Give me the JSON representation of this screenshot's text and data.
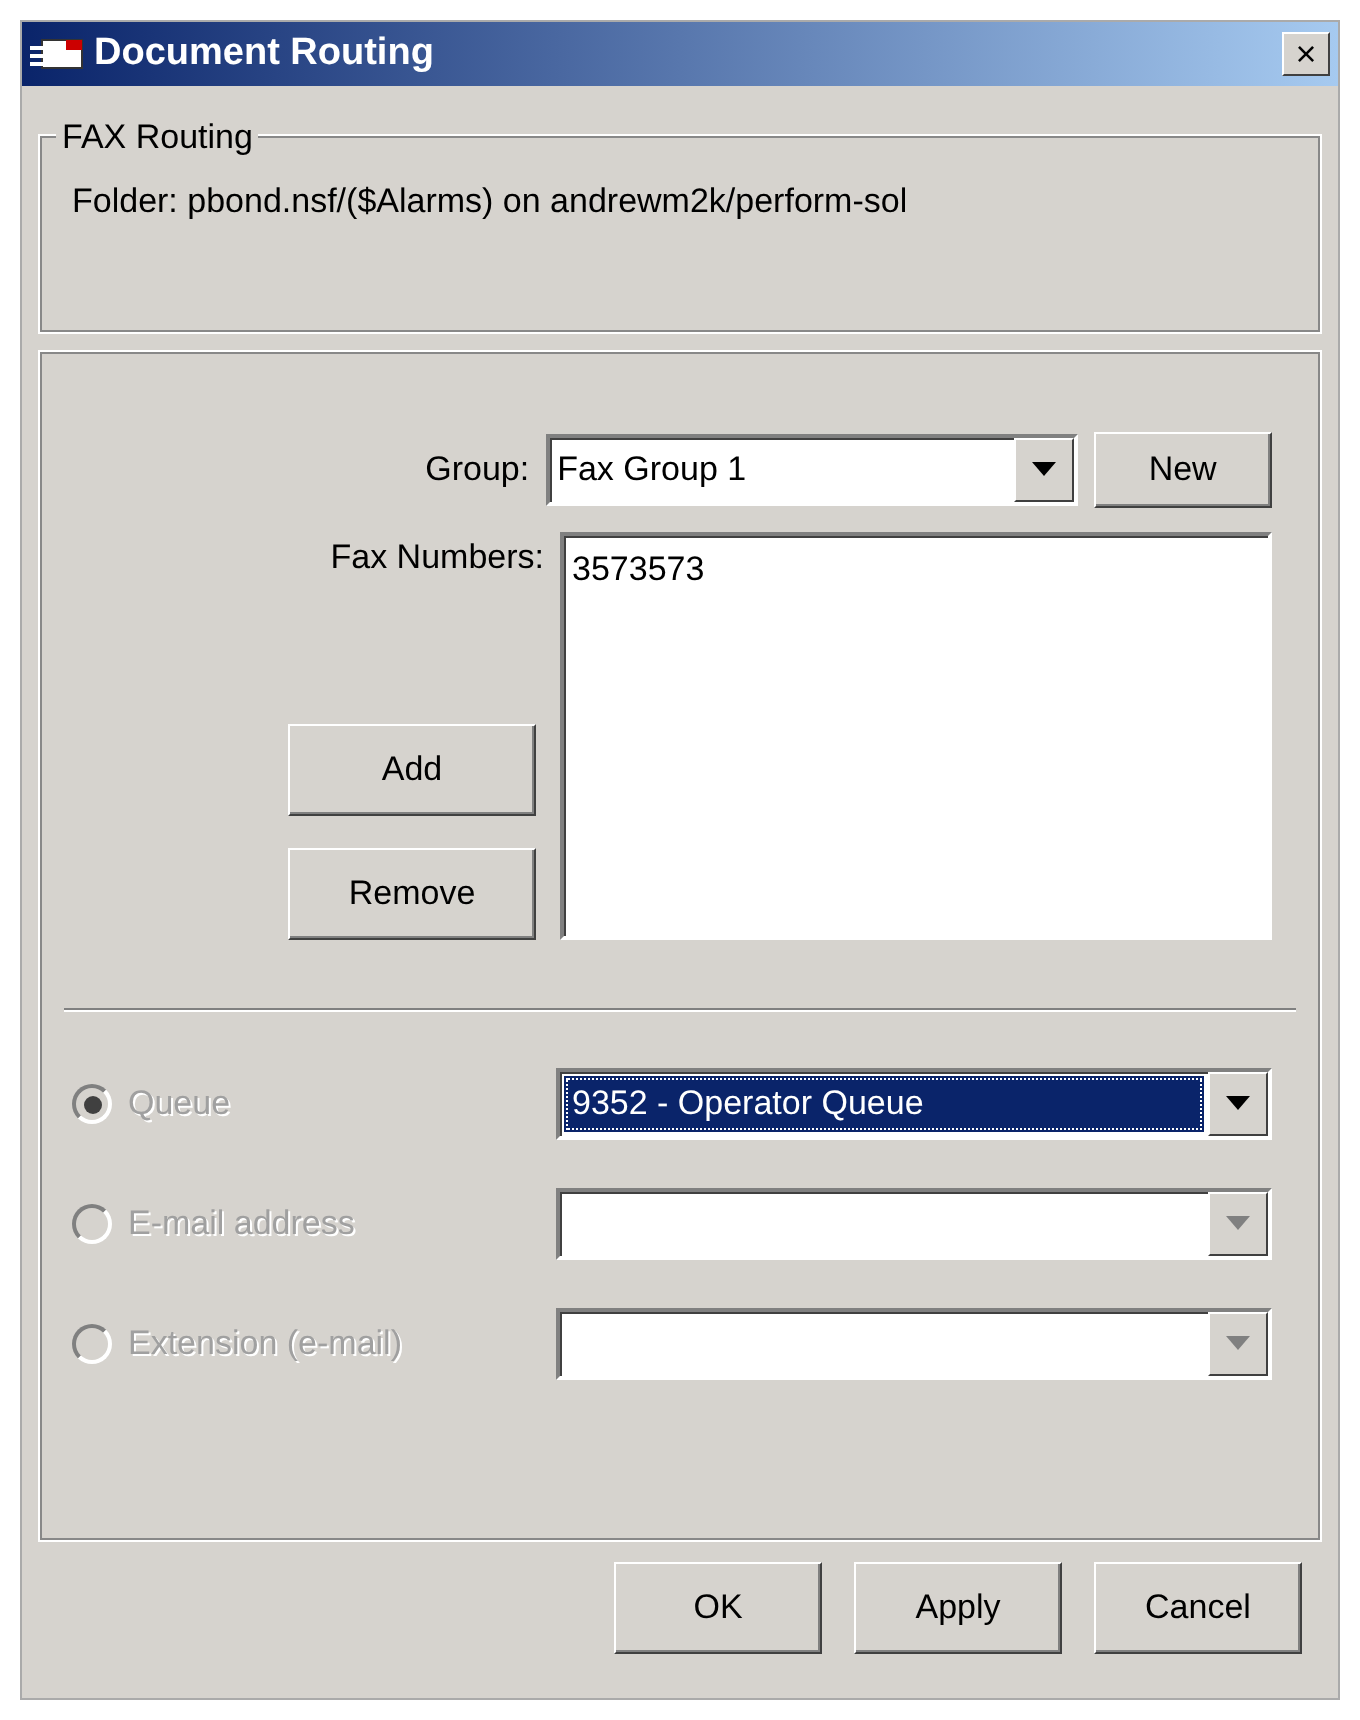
{
  "window": {
    "title": "Document Routing",
    "close": "×"
  },
  "fax_routing": {
    "legend": "FAX Routing",
    "folder": "Folder: pbond.nsf/($Alarms) on andrewm2k/perform-sol"
  },
  "group": {
    "label": "Group:",
    "value": "Fax Group 1",
    "new_button": "New"
  },
  "fax_numbers": {
    "label": "Fax Numbers:",
    "items": [
      "3573573"
    ],
    "add_button": "Add",
    "remove_button": "Remove"
  },
  "routes": [
    {
      "label": "Queue",
      "selected": true,
      "disabled": true,
      "value": "9352 - Operator Queue",
      "focused": true
    },
    {
      "label": "E-mail address",
      "selected": false,
      "disabled": true,
      "focused": false
    },
    {
      "label": "Extension (e-mail)",
      "selected": false,
      "disabled": true,
      "focused": false
    }
  ],
  "buttons": [
    "OK",
    "Apply",
    "Cancel"
  ]
}
